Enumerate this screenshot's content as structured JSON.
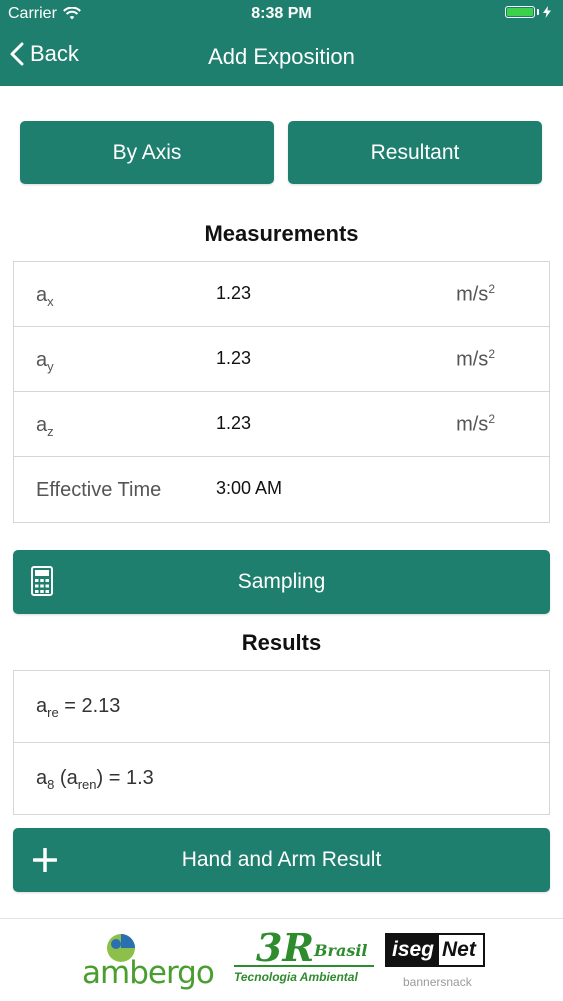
{
  "status_bar": {
    "carrier": "Carrier",
    "time": "8:38 PM",
    "wifi_icon": "wifi-icon",
    "battery_icon": "battery-icon",
    "charging_icon": "bolt-icon"
  },
  "nav": {
    "back_label": "Back",
    "title": "Add Exposition"
  },
  "mode_tabs": [
    {
      "label": "By Axis"
    },
    {
      "label": "Resultant"
    }
  ],
  "measurements": {
    "title": "Measurements",
    "rows": [
      {
        "symbol": "a",
        "sub": "x",
        "value": "1.23",
        "unit": "m/s",
        "unit_exp": "2"
      },
      {
        "symbol": "a",
        "sub": "y",
        "value": "1.23",
        "unit": "m/s",
        "unit_exp": "2"
      },
      {
        "symbol": "a",
        "sub": "z",
        "value": "1.23",
        "unit": "m/s",
        "unit_exp": "2"
      },
      {
        "label": "Effective Time",
        "value": "3:00 AM"
      }
    ]
  },
  "sampling": {
    "label": "Sampling",
    "icon": "calculator-icon"
  },
  "results": {
    "title": "Results",
    "are": {
      "symbol": "a",
      "sub": "re",
      "rest": " = 2.13"
    },
    "a8": {
      "symbol": "a",
      "sub": "8",
      "mid": " (a",
      "sub2": "ren",
      "rest": ") = 1.3"
    }
  },
  "hand_arm": {
    "label": "Hand and Arm Result",
    "icon": "plus-icon"
  },
  "footer": {
    "logos": [
      {
        "name": "ambergo",
        "text": "ambergo"
      },
      {
        "name": "3r-brasil",
        "text": "3R",
        "text2": "Brasil",
        "tagline": "Tecnologia Ambiental"
      },
      {
        "name": "iseg-net",
        "text": "iseg",
        "text2": "Net",
        "credit": "bannersnack"
      }
    ]
  },
  "colors": {
    "primary": "#1f7f6e",
    "logo_green": "#4a9e2f",
    "logo_blue": "#2a6fb0"
  }
}
